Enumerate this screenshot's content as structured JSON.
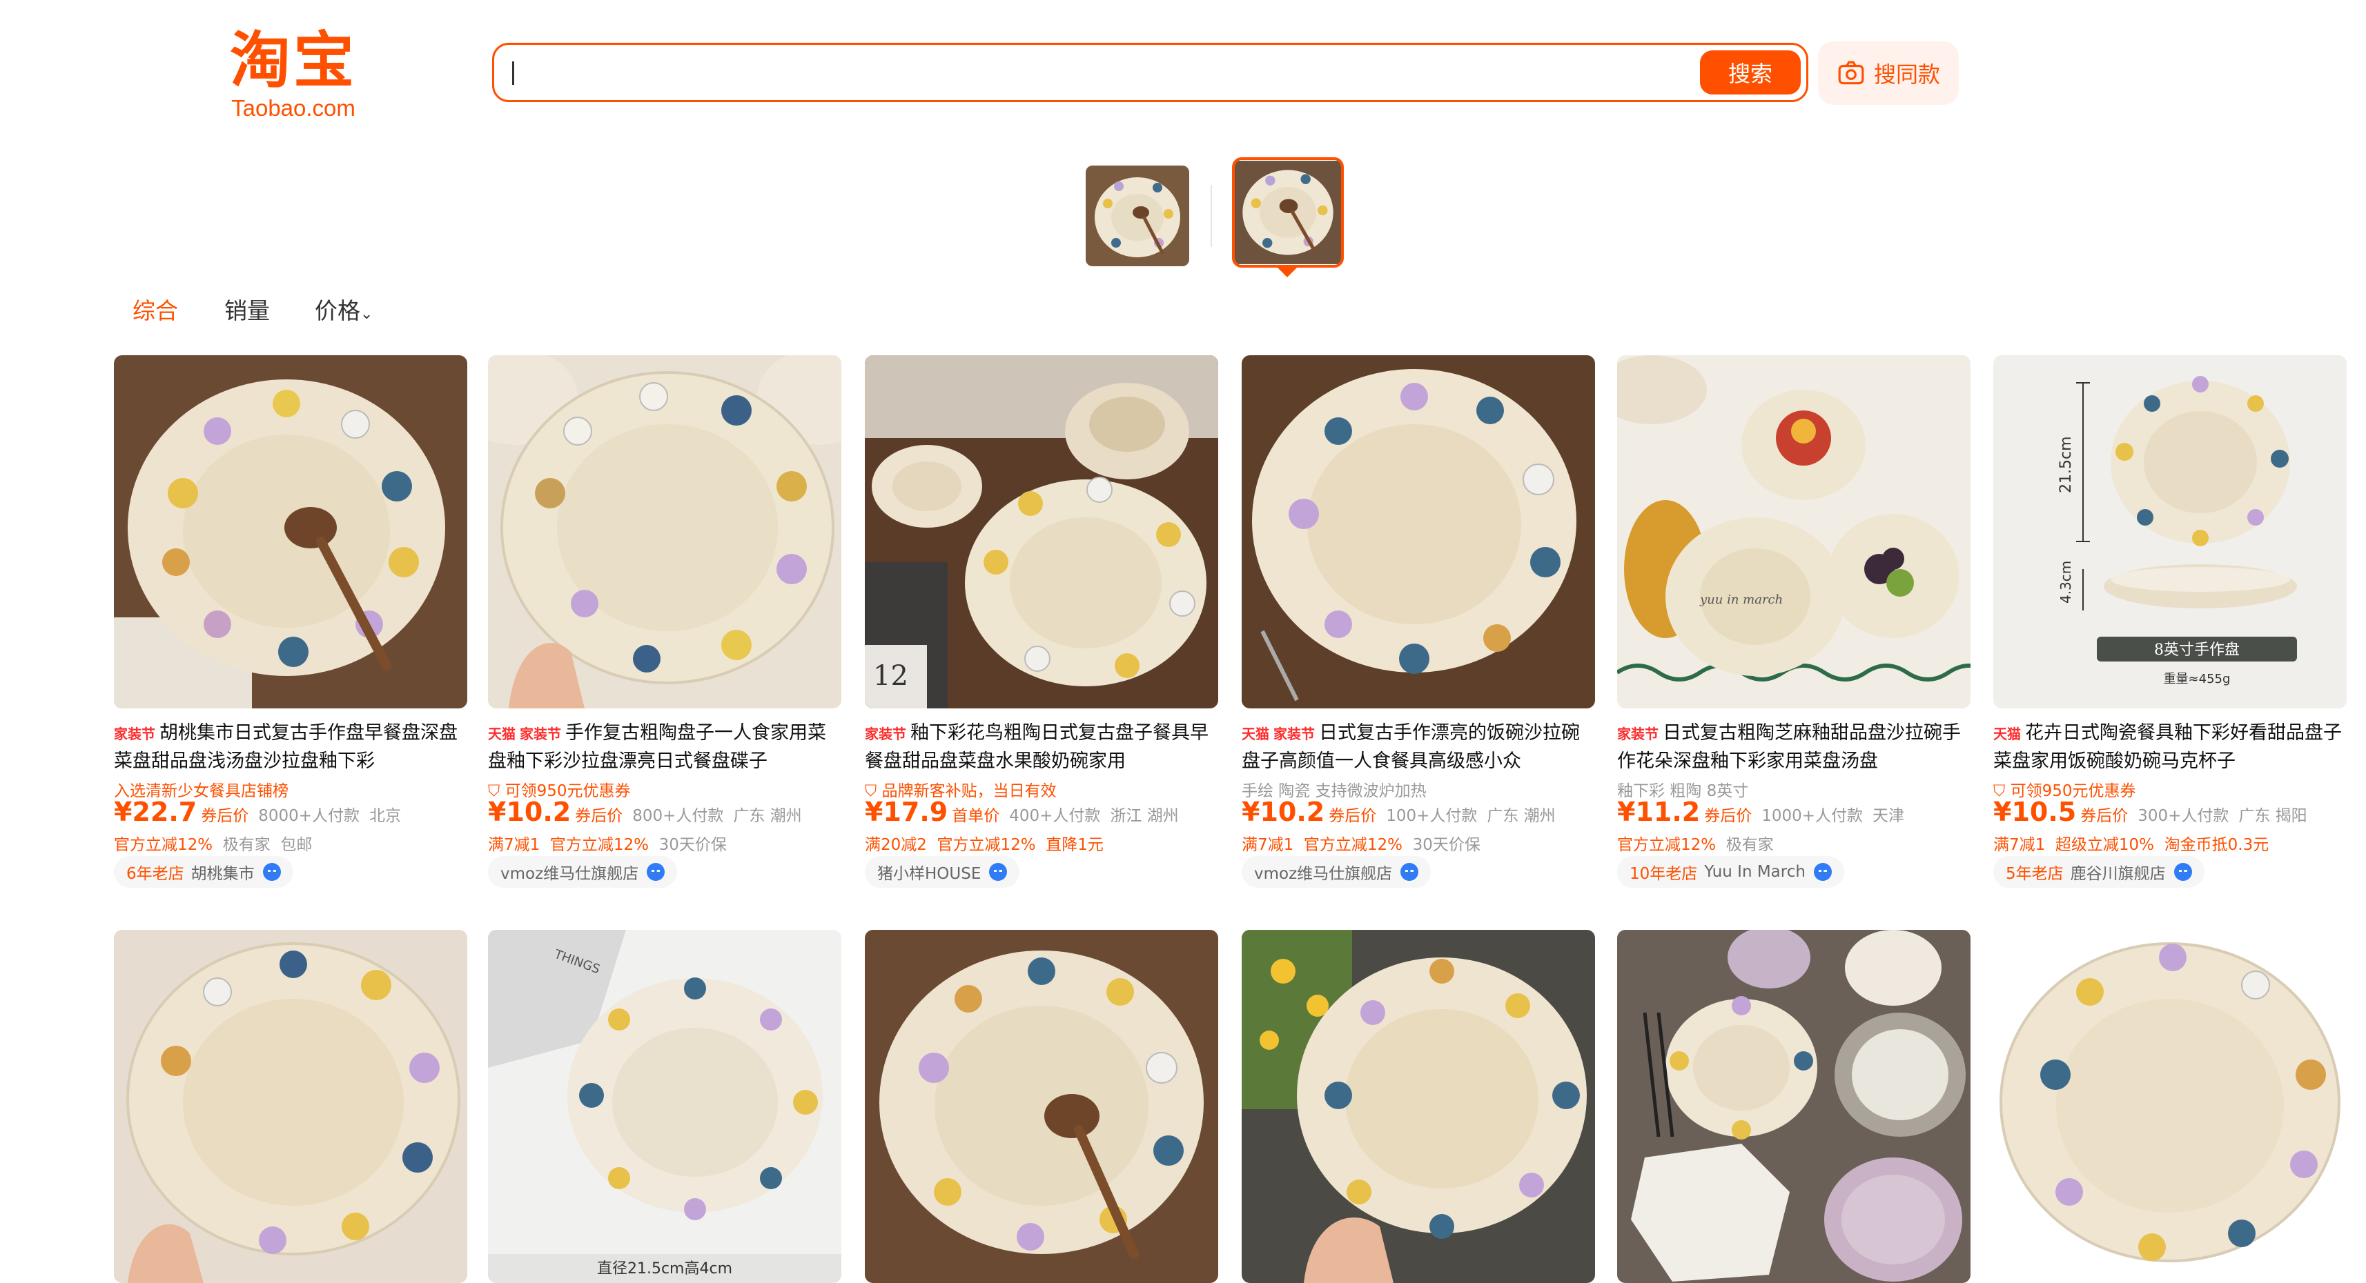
{
  "header": {
    "logo_cn": "淘宝",
    "logo_en": "Taobao.com",
    "search_value": "",
    "search_button": "搜索",
    "same_button": "搜同款"
  },
  "sort_tabs": [
    {
      "label": "综合",
      "active": true
    },
    {
      "label": "销量",
      "active": false
    },
    {
      "label": "价格",
      "active": false
    }
  ],
  "colors": {
    "accent": "#ff5000",
    "tmall_tag": "#ff2b2b",
    "wangwang": "#2f7cf6"
  },
  "products": [
    {
      "tags": [
        "家装节"
      ],
      "title": "胡桃集市日式复古手作盘早餐盘深盘菜盘甜品盘浅汤盘沙拉盘釉下彩",
      "promo": "入选清新少女餐具店铺榜",
      "promo_grey": false,
      "price": "¥22.7",
      "price_note": "券后价",
      "sold": "8000+人付款",
      "location": "北京",
      "benefits": [
        "官方立减12%",
        "极有家",
        "包邮"
      ],
      "shop_age": "6年老店",
      "shop": "胡桃集市"
    },
    {
      "tags": [
        "天猫",
        "家装节"
      ],
      "title": "手作复古粗陶盘子一人食家用菜盘釉下彩沙拉盘漂亮日式餐盘碟子",
      "promo": "可领950元优惠券",
      "promo_grey": false,
      "price": "¥10.2",
      "price_note": "券后价",
      "sold": "800+人付款",
      "location": "广东 潮州",
      "benefits": [
        "满7减1",
        "官方立减12%",
        "30天价保"
      ],
      "shop_age": "",
      "shop": "vmoz维马仕旗舰店"
    },
    {
      "tags": [
        "家装节"
      ],
      "title": "釉下彩花鸟粗陶日式复古盘子餐具早餐盘甜品盘菜盘水果酸奶碗家用",
      "promo": "品牌新客补贴，当日有效",
      "promo_grey": false,
      "price": "¥17.9",
      "price_note": "首单价",
      "sold": "400+人付款",
      "location": "浙江 湖州",
      "benefits": [
        "满20减2",
        "官方立减12%",
        "直降1元"
      ],
      "shop_age": "",
      "shop": "猪小样HOUSE"
    },
    {
      "tags": [
        "天猫",
        "家装节"
      ],
      "title": "日式复古手作漂亮的饭碗沙拉碗盘子高颜值一人食餐具高级感小众",
      "promo": "手绘   陶瓷   支持微波炉加热",
      "promo_grey": true,
      "price": "¥10.2",
      "price_note": "券后价",
      "sold": "100+人付款",
      "location": "广东 潮州",
      "benefits": [
        "满7减1",
        "官方立减12%",
        "30天价保"
      ],
      "shop_age": "",
      "shop": "vmoz维马仕旗舰店"
    },
    {
      "tags": [
        "家装节"
      ],
      "title": "日式复古粗陶芝麻釉甜品盘沙拉碗手作花朵深盘釉下彩家用菜盘汤盘",
      "promo": "釉下彩   粗陶   8英寸",
      "promo_grey": true,
      "price": "¥11.2",
      "price_note": "券后价",
      "sold": "1000+人付款",
      "location": "天津",
      "benefits": [
        "官方立减12%",
        "极有家"
      ],
      "shop_age": "10年老店",
      "shop": "Yuu In March"
    },
    {
      "tags": [
        "天猫"
      ],
      "title": "花卉日式陶瓷餐具釉下彩好看甜品盘子菜盘家用饭碗酸奶碗马克杯子",
      "promo": "可领950元优惠券",
      "promo_grey": false,
      "price": "¥10.5",
      "price_note": "券后价",
      "sold": "300+人付款",
      "location": "广东 揭阳",
      "benefits": [
        "满7减1",
        "超级立减10%",
        "淘金币抵0.3元"
      ],
      "shop_age": "5年老店",
      "shop": "鹿谷川旗舰店"
    }
  ],
  "image_texts": {
    "p6_width": "21.5cm",
    "p6_height": "4.3cm",
    "p6_badge": "8英寸手作盘",
    "p6_weight": "重量≈455g",
    "p3_calendar": "12",
    "r2_caption": "直径21.5cm高4cm",
    "r2_book": "THINGS",
    "p5_script": "yuu in march"
  },
  "icons": [
    "camera-icon",
    "wangwang-chat-icon",
    "coupon-icon",
    "chevron-down-icon"
  ]
}
